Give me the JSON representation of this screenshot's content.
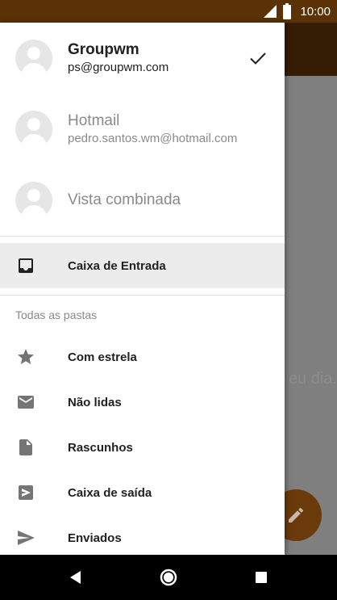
{
  "status_bar": {
    "time": "10:00",
    "icons": [
      "signal-icon",
      "battery-icon"
    ]
  },
  "background_app": {
    "empty_text": "eu dia.",
    "fab_icon": "edit-icon",
    "colors": {
      "toolbar": "#6a3a0b",
      "status": "#5b3206"
    }
  },
  "drawer": {
    "accounts": [
      {
        "name": "Groupwm",
        "email": "ps@groupwm.com",
        "active": true
      },
      {
        "name": "Hotmail",
        "email": "pedro.santos.wm@hotmail.com",
        "active": false
      },
      {
        "name": "Vista combinada",
        "active": false
      }
    ],
    "inbox": {
      "label": "Caixa de Entrada",
      "icon": "inbox-icon"
    },
    "section_title": "Todas as pastas",
    "folders": [
      {
        "label": "Com estrela",
        "icon": "star-icon"
      },
      {
        "label": "Não lidas",
        "icon": "mail-icon"
      },
      {
        "label": "Rascunhos",
        "icon": "draft-icon"
      },
      {
        "label": "Caixa de saída",
        "icon": "outbox-icon"
      },
      {
        "label": "Enviados",
        "icon": "send-icon"
      }
    ]
  },
  "nav_bar": {
    "buttons": [
      "back-icon",
      "home-icon",
      "recents-icon"
    ]
  }
}
